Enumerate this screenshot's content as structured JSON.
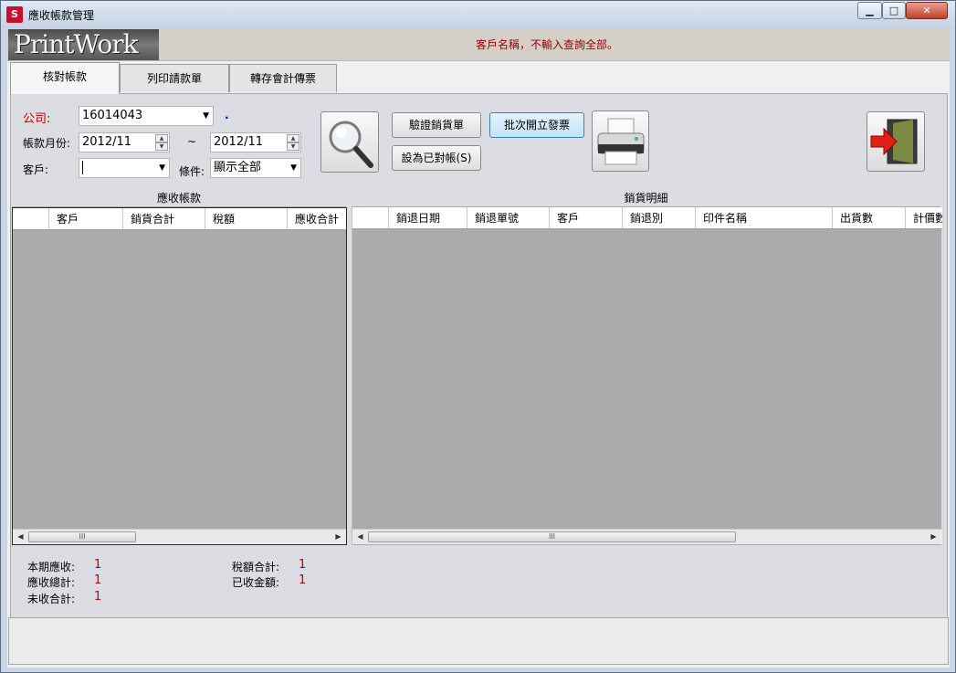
{
  "window": {
    "title": "應收帳款管理",
    "app_icon_text": "S",
    "buttons": {
      "minimize": "▁",
      "maximize": "□",
      "close": "✕"
    }
  },
  "banner": {
    "logo": "PrintWork",
    "message": "客戶名稱，不輸入查詢全部。"
  },
  "tabs": [
    {
      "label": "核對帳款",
      "active": true
    },
    {
      "label": "列印請款單",
      "active": false
    },
    {
      "label": "轉存會計傳票",
      "active": false
    }
  ],
  "filters": {
    "company_label": "公司:",
    "company_value": "16014043",
    "dot": ".",
    "month_label": "帳款月份:",
    "month_from": "2012/11",
    "tilde": "~",
    "month_to": "2012/11",
    "customer_label": "客戶:",
    "customer_value": "",
    "condition_label": "條件:",
    "condition_value": "顯示全部"
  },
  "actions": {
    "verify_label": "驗證銷貨單",
    "batch_invoice_label": "批次開立發票",
    "set_checked_label": "設為已對帳(S)"
  },
  "left_grid": {
    "caption": "應收帳款",
    "columns": [
      "",
      "客戶",
      "銷貨合計",
      "稅額",
      "應收合計"
    ]
  },
  "right_grid": {
    "caption": "銷貨明細",
    "columns": [
      "",
      "銷退日期",
      "銷退單號",
      "客戶",
      "銷退別",
      "印件名稱",
      "出貨數",
      "計價數"
    ]
  },
  "scroll": {
    "left_arrow": "◀",
    "right_arrow": "▶",
    "grip": "III"
  },
  "summary": {
    "period_receivable_label": "本期應收:",
    "period_receivable_value": "1",
    "total_receivable_label": "應收總計:",
    "total_receivable_value": "1",
    "uncollected_label": "未收合計:",
    "uncollected_value": "1",
    "tax_total_label": "稅額合計:",
    "tax_total_value": "1",
    "collected_label": "已收金額:",
    "collected_value": "1"
  },
  "colors": {
    "accent_red": "#c00000",
    "grid_bg": "#ababab",
    "panel_bg": "#dcdde3"
  }
}
